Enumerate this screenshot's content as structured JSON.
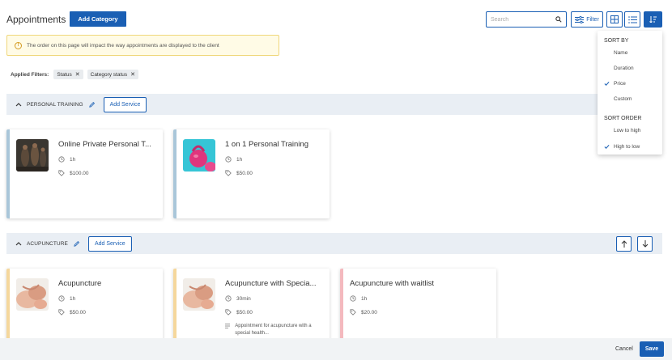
{
  "header": {
    "title": "Appointments",
    "add_category_label": "Add Category",
    "search_placeholder": "Search",
    "filter_label": "Filter"
  },
  "banner": {
    "text": "The order on this page will impact the way appointments are displayed to the client"
  },
  "filters": {
    "label": "Applied Filters:",
    "chips": [
      "Status",
      "Category status"
    ]
  },
  "categories": [
    {
      "name": "PERSONAL TRAINING",
      "add_service_label": "Add Service",
      "services": [
        {
          "name": "Online Private Personal T...",
          "duration": "1h",
          "price": "$100.00",
          "accent": "#a9c6d9",
          "icon": "fitness-photo-icon"
        },
        {
          "name": "1 on 1 Personal Training",
          "duration": "1h",
          "price": "$50.00",
          "accent": "#a9c6d9",
          "icon": "kettlebell-photo-icon"
        }
      ]
    },
    {
      "name": "ACUPUNCTURE",
      "add_service_label": "Add Service",
      "services": [
        {
          "name": "Acupuncture",
          "duration": "1h",
          "price": "$50.00",
          "accent": "#f5d79c",
          "icon": "hands-photo-icon"
        },
        {
          "name": "Acupuncture with Specia...",
          "duration": "30min",
          "price": "$50.00",
          "description": "Appointment for acupuncture with a special health...",
          "accent": "#f5d79c",
          "icon": "hands-photo-icon"
        },
        {
          "name": "Acupuncture with waitlist",
          "duration": "1h",
          "price": "$20.00",
          "accent": "#f4b9be"
        }
      ]
    }
  ],
  "sort_menu": {
    "sort_by_label": "SORT BY",
    "sort_by_options": [
      "Name",
      "Duration",
      "Price",
      "Custom"
    ],
    "sort_by_selected": "Price",
    "sort_order_label": "SORT ORDER",
    "sort_order_options": [
      "Low to high",
      "High to low"
    ],
    "sort_order_selected": "High to low"
  },
  "footer": {
    "cancel_label": "Cancel",
    "save_label": "Save"
  },
  "colors": {
    "primary": "#1a5fb4",
    "category_band": "#e9eef4",
    "banner_bg": "#fffbe6",
    "banner_border": "#f0d77a"
  }
}
